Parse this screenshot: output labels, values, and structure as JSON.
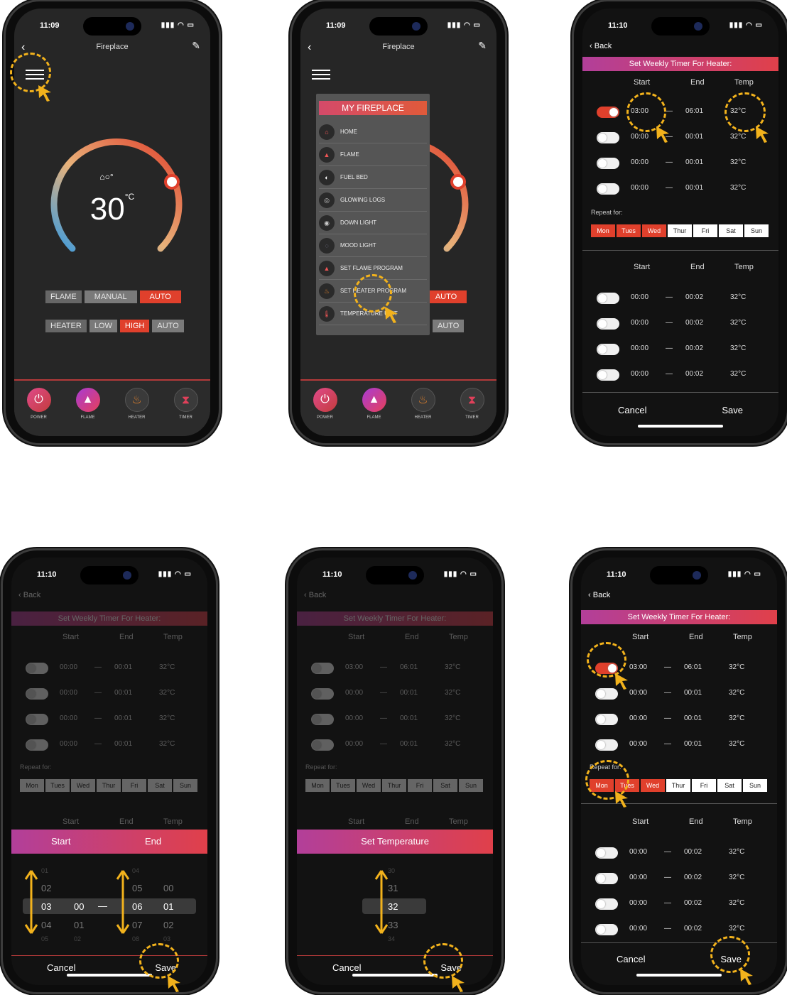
{
  "status": {
    "time_a": "11:09",
    "time_b": "11:10",
    "signal": "▮▮▮ ◠ ▭"
  },
  "fireplace": {
    "nav_title": "Fireplace",
    "temp": "30",
    "temp_unit": "°C",
    "home_badge": "⌂○°",
    "flame_row": {
      "label": "FLAME",
      "manual": "MANUAL",
      "auto": "AUTO"
    },
    "heater_row": {
      "label": "HEATER",
      "low": "LOW",
      "high": "HIGH",
      "auto": "AUTO"
    },
    "bottom_nav": {
      "power": "POWER",
      "flame": "FLAME",
      "heater": "HEATER",
      "timer": "TIMER"
    }
  },
  "menu": {
    "header": "MY FIREPLACE",
    "items": [
      "HOME",
      "FLAME",
      "FUEL BED",
      "GLOWING LOGS",
      "DOWN LIGHT",
      "MOOD LIGHT",
      "SET FLAME PROGRAM",
      "SET HEATER PROGRAM",
      "TEMPERATURE UNIT"
    ]
  },
  "timer": {
    "back": "Back",
    "title": "Set Weekly Timer For Heater:",
    "col_start": "Start",
    "col_end": "End",
    "col_temp": "Temp",
    "dash": "—",
    "rows_a": [
      {
        "start": "03:00",
        "end": "06:01",
        "temp": "32°C"
      },
      {
        "start": "00:00",
        "end": "00:01",
        "temp": "32°C"
      },
      {
        "start": "00:00",
        "end": "00:01",
        "temp": "32°C"
      },
      {
        "start": "00:00",
        "end": "00:01",
        "temp": "32°C"
      }
    ],
    "rows_b": [
      {
        "start": "00:00",
        "end": "00:02",
        "temp": "32°C"
      },
      {
        "start": "00:00",
        "end": "00:02",
        "temp": "32°C"
      },
      {
        "start": "00:00",
        "end": "00:02",
        "temp": "32°C"
      },
      {
        "start": "00:00",
        "end": "00:02",
        "temp": "32°C"
      }
    ],
    "repeat_label": "Repeat for:",
    "days": [
      "Mon",
      "Tues",
      "Wed",
      "Thur",
      "Fri",
      "Sat",
      "Sun"
    ],
    "cancel": "Cancel",
    "save": "Save"
  },
  "picker_time": {
    "start_label": "Start",
    "end_label": "End",
    "hour_above": "01",
    "hour_up": "02",
    "hour": "03",
    "hour_down": "04",
    "hour_below": "05",
    "min_up": "",
    "min": "00",
    "min_down": "01",
    "min_below": "02",
    "ehour_above": "04",
    "ehour_up": "05",
    "ehour": "06",
    "ehour_down": "07",
    "ehour_below": "08",
    "emin_up": "00",
    "emin": "01",
    "emin_down": "02",
    "emin_below": "03"
  },
  "picker_temp": {
    "title": "Set Temperature",
    "v_above": "30",
    "v_up": "31",
    "v": "32",
    "v_down": "33",
    "v_below": "34"
  },
  "colors": {
    "accent": "#e0402c",
    "highlight": "#f2b21c",
    "pink": "#b23f9a"
  }
}
